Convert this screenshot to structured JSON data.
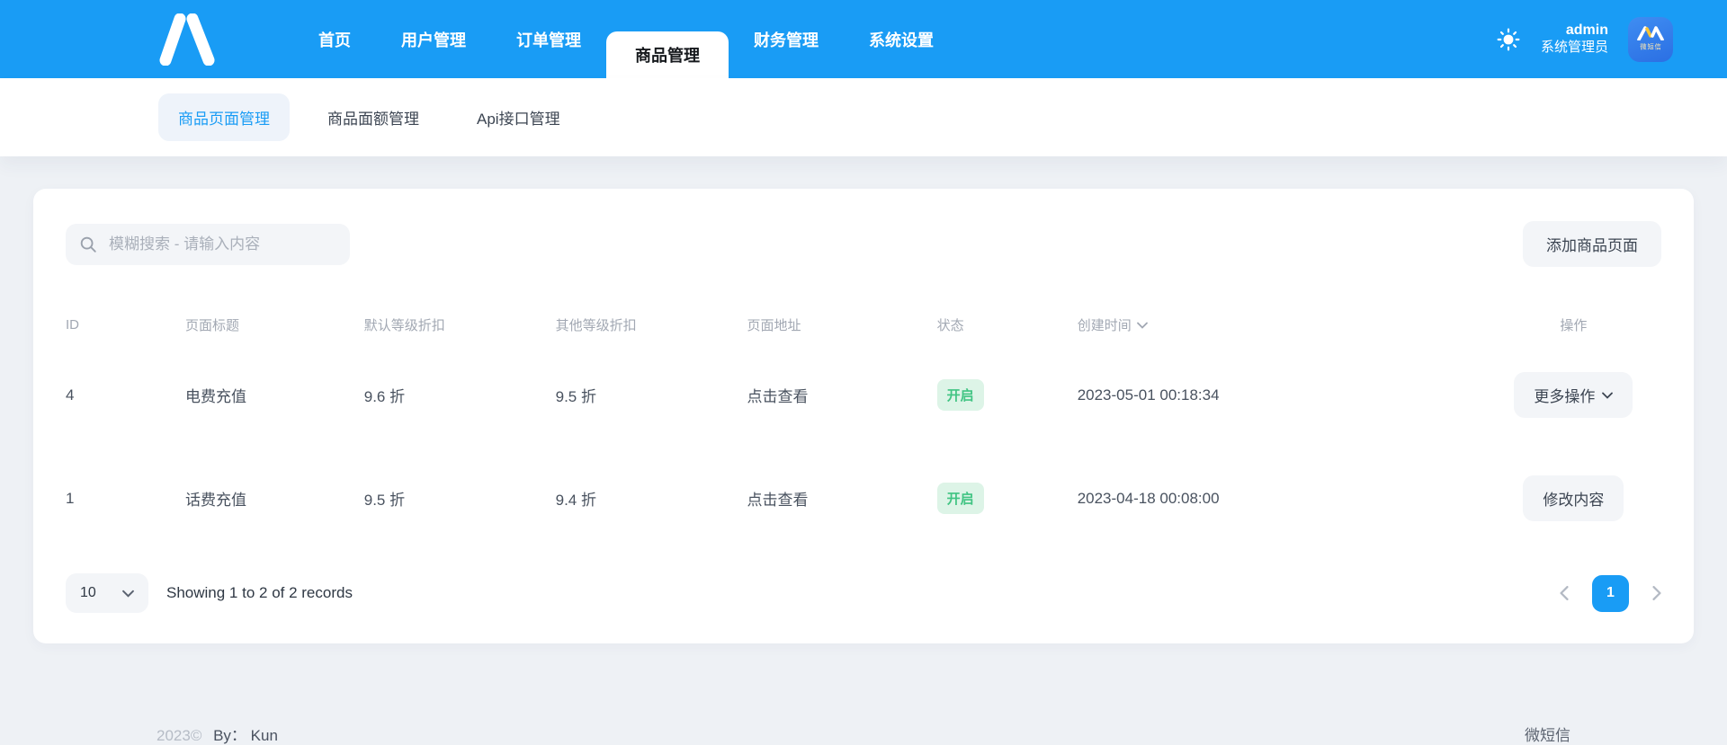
{
  "colors": {
    "accent": "#199cf5",
    "header_bg": "#199cf5",
    "badge_bg": "#ddf4e7",
    "badge_text": "#41c483",
    "page_bg": "#eef1f5"
  },
  "header": {
    "nav": [
      {
        "label": "首页",
        "active": false
      },
      {
        "label": "用户管理",
        "active": false
      },
      {
        "label": "订单管理",
        "active": false
      },
      {
        "label": "商品管理",
        "active": true
      },
      {
        "label": "财务管理",
        "active": false
      },
      {
        "label": "系统设置",
        "active": false
      }
    ],
    "user": {
      "name": "admin",
      "role": "系统管理员"
    },
    "avatar_text": "微短信"
  },
  "subnav": {
    "items": [
      {
        "label": "商品页面管理",
        "active": true
      },
      {
        "label": "商品面额管理",
        "active": false
      },
      {
        "label": "Api接口管理",
        "active": false
      }
    ]
  },
  "toolbar": {
    "search_placeholder": "模糊搜索 - 请输入内容",
    "add_button": "添加商品页面"
  },
  "table": {
    "columns": [
      "ID",
      "页面标题",
      "默认等级折扣",
      "其他等级折扣",
      "页面地址",
      "状态",
      "创建时间",
      "操作"
    ],
    "rows": [
      {
        "id": "4",
        "title": "电费充值",
        "default_discount": "9.6 折",
        "other_discount": "9.5 折",
        "page_link": "点击查看",
        "status": "开启",
        "created_at": "2023-05-01 00:18:34",
        "action": "更多操作"
      },
      {
        "id": "1",
        "title": "话费充值",
        "default_discount": "9.5 折",
        "other_discount": "9.4 折",
        "page_link": "点击查看",
        "status": "开启",
        "created_at": "2023-04-18 00:08:00",
        "action": "修改内容"
      }
    ]
  },
  "pagination": {
    "page_size": "10",
    "summary": "Showing 1 to 2 of 2 records",
    "current_page": "1"
  },
  "footer": {
    "year": "2023©",
    "author": "By： Kun",
    "right": "微短信"
  }
}
